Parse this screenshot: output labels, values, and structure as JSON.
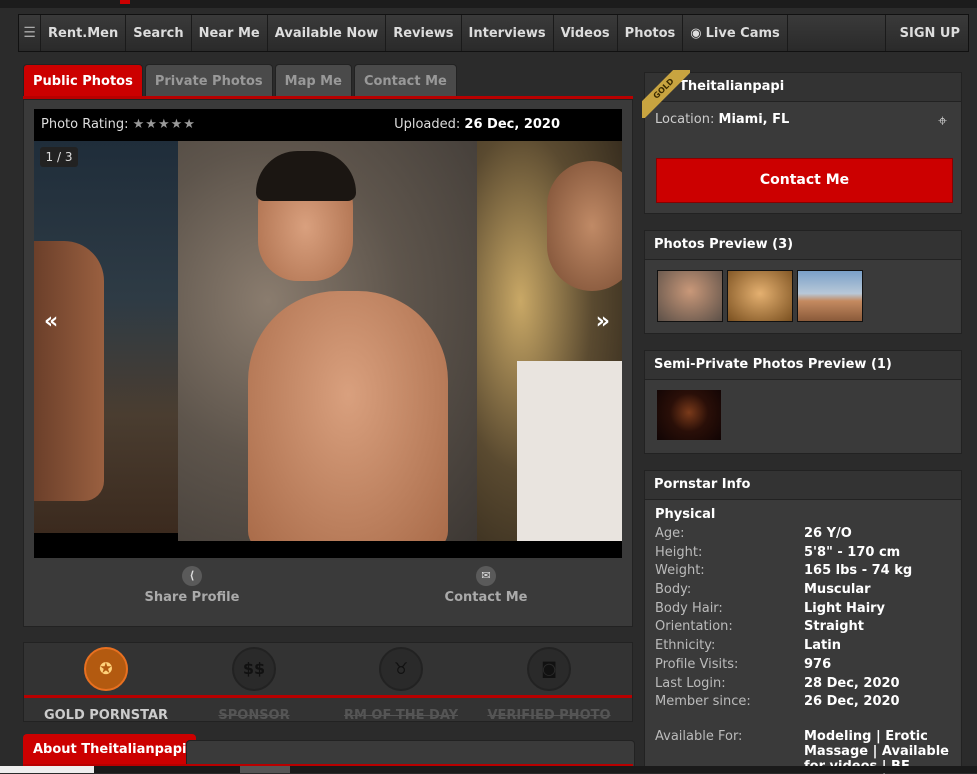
{
  "nav": {
    "items": [
      "Rent.Men",
      "Search",
      "Near Me",
      "Available Now",
      "Reviews",
      "Interviews",
      "Videos",
      "Photos",
      "Live Cams"
    ],
    "signup": "SIGN UP"
  },
  "tabs": [
    "Public Photos",
    "Private Photos",
    "Map Me",
    "Contact Me"
  ],
  "viewer": {
    "rating_label": "Photo Rating:",
    "rating_stars": "★★★★★",
    "uploaded_label": "Uploaded:",
    "uploaded_date": "26 Dec, 2020",
    "counter": "1 / 3",
    "prev": "«",
    "next": "»"
  },
  "actions": {
    "share": "Share Profile",
    "contact": "Contact Me"
  },
  "badges": [
    {
      "label": "GOLD PORNSTAR",
      "active": true
    },
    {
      "label": "SPONSOR",
      "active": false
    },
    {
      "label": "RM OF THE DAY",
      "active": false
    },
    {
      "label": "VERIFIED PHOTO",
      "active": false
    }
  ],
  "about_tab": "About Theitalianpapi",
  "profile": {
    "tier": "GOLD",
    "username": "Theitalianpapi",
    "location_label": "Location:",
    "location": "Miami, FL",
    "contact_button": "Contact Me"
  },
  "photos_preview": {
    "title": "Photos Preview (3)"
  },
  "semi_private": {
    "title": "Semi-Private Photos Preview (1)"
  },
  "pornstar_info": {
    "title": "Pornstar Info",
    "section": "Physical",
    "rows": [
      {
        "k": "Age:",
        "v": "26 Y/O"
      },
      {
        "k": "Height:",
        "v": "5'8\" - 170 cm"
      },
      {
        "k": "Weight:",
        "v": "165 lbs - 74 kg"
      },
      {
        "k": "Body:",
        "v": "Muscular"
      },
      {
        "k": "Body Hair:",
        "v": "Light Hairy"
      },
      {
        "k": "Orientation:",
        "v": "Straight"
      },
      {
        "k": "Ethnicity:",
        "v": "Latin"
      },
      {
        "k": "Profile Visits:",
        "v": "976"
      },
      {
        "k": "Last Login:",
        "v": "28 Dec, 2020"
      },
      {
        "k": "Member since:",
        "v": "26 Dec, 2020"
      }
    ],
    "available_label": "Available For:",
    "available_value": "Modeling | Erotic Massage | Available for videos | BF"
  }
}
